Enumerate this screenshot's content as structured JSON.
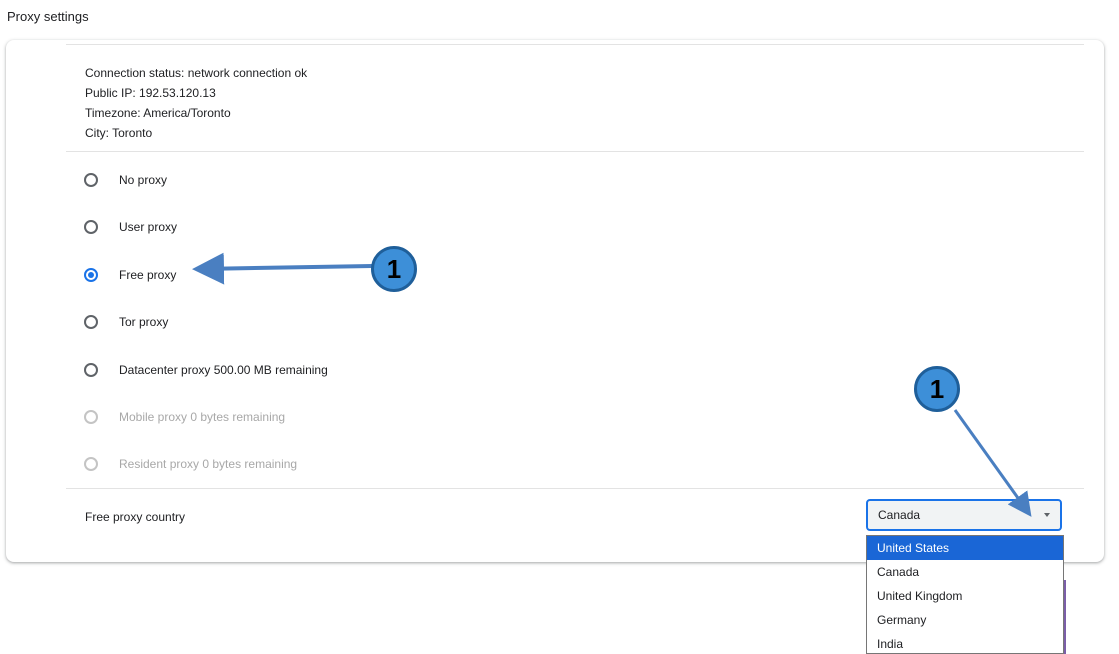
{
  "page": {
    "title": "Proxy settings"
  },
  "status": {
    "connection": "Connection status: network connection ok",
    "public_ip": "Public IP: 192.53.120.13",
    "timezone": "Timezone: America/Toronto",
    "city": "City: Toronto"
  },
  "proxy_options": [
    {
      "label": "No proxy",
      "checked": false,
      "disabled": false
    },
    {
      "label": "User proxy",
      "checked": false,
      "disabled": false
    },
    {
      "label": "Free proxy",
      "checked": true,
      "disabled": false
    },
    {
      "label": "Tor proxy",
      "checked": false,
      "disabled": false
    },
    {
      "label": "Datacenter proxy 500.00 MB remaining",
      "checked": false,
      "disabled": false
    },
    {
      "label": "Mobile proxy 0 bytes remaining",
      "checked": false,
      "disabled": true
    },
    {
      "label": "Resident proxy 0 bytes remaining",
      "checked": false,
      "disabled": true
    }
  ],
  "country": {
    "label": "Free proxy country",
    "selected": "Canada",
    "options": [
      "United States",
      "Canada",
      "United Kingdom",
      "Germany",
      "India"
    ],
    "highlighted": "United States"
  },
  "annotations": {
    "step1": "1",
    "step2": "1",
    "color": "#3d8fd8",
    "arrow_color": "#4a7fc1"
  },
  "colors": {
    "accent": "#1a73e8",
    "disabled": "#a8a8a8"
  }
}
